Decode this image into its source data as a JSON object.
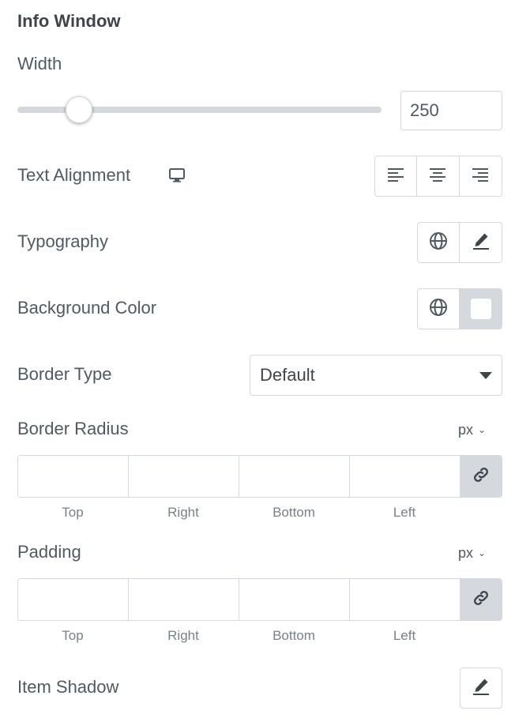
{
  "section": {
    "title": "Info Window"
  },
  "width": {
    "label": "Width",
    "value": "250",
    "slider_fraction": 0.17
  },
  "text_alignment": {
    "label": "Text Alignment",
    "responsive_icon": "desktop-icon",
    "options": [
      "align-left-icon",
      "align-center-icon",
      "align-right-icon"
    ]
  },
  "typography": {
    "label": "Typography",
    "icons": [
      "globe-icon",
      "pencil-icon"
    ]
  },
  "background_color": {
    "label": "Background Color",
    "icons": [
      "globe-icon"
    ],
    "swatch_color": "#ffffff"
  },
  "border_type": {
    "label": "Border Type",
    "selected": "Default"
  },
  "border_radius": {
    "label": "Border Radius",
    "unit": "px",
    "sides": [
      "Top",
      "Right",
      "Bottom",
      "Left"
    ],
    "link_icon": "link-icon"
  },
  "padding": {
    "label": "Padding",
    "unit": "px",
    "sides": [
      "Top",
      "Right",
      "Bottom",
      "Left"
    ],
    "link_icon": "link-icon"
  },
  "item_shadow": {
    "label": "Item Shadow",
    "icon": "pencil-icon"
  },
  "colors": {
    "border": "#d5d8dc",
    "text": "#515962",
    "heading": "#3f444b",
    "link_bg": "#d5d8dc"
  }
}
